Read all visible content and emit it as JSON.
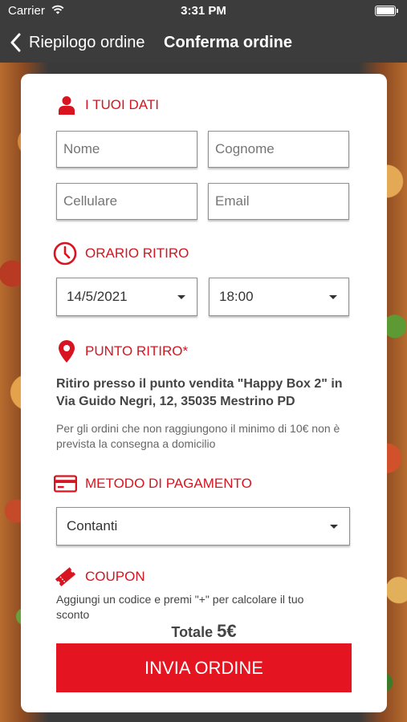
{
  "status_bar": {
    "carrier": "Carrier",
    "time": "3:31 PM"
  },
  "nav": {
    "back_label": "Riepilogo ordine",
    "title": "Conferma ordine"
  },
  "colors": {
    "accent": "#d7141f",
    "button": "#e41420",
    "bar": "#3c3c3c"
  },
  "personal": {
    "title": "I TUOI DATI",
    "icon": "user-icon",
    "first_name_placeholder": "Nome",
    "last_name_placeholder": "Cognome",
    "phone_placeholder": "Cellulare",
    "email_placeholder": "Email"
  },
  "pickup_time": {
    "title": "ORARIO RITIRO",
    "icon": "clock-icon",
    "date": "14/5/2021",
    "time": "18:00"
  },
  "pickup_point": {
    "title": "PUNTO RITIRO*",
    "icon": "location-pin-icon",
    "address": "Ritiro presso il punto vendita \"Happy Box 2\" in Via Guido Negri, 12, 35035 Mestrino PD",
    "note": "Per gli ordini che non raggiungono il minimo di 10€ non è prevista la consegna a domicilio"
  },
  "payment": {
    "title": "METODO DI PAGAMENTO",
    "icon": "credit-card-icon",
    "selected": "Contanti"
  },
  "coupon": {
    "title": "COUPON",
    "icon": "ticket-icon",
    "note": "Aggiungi un codice e premi \"+\" per calcolare il tuo sconto"
  },
  "total": {
    "label": "Totale",
    "amount": "5€"
  },
  "submit_label": "INVIA ORDINE"
}
